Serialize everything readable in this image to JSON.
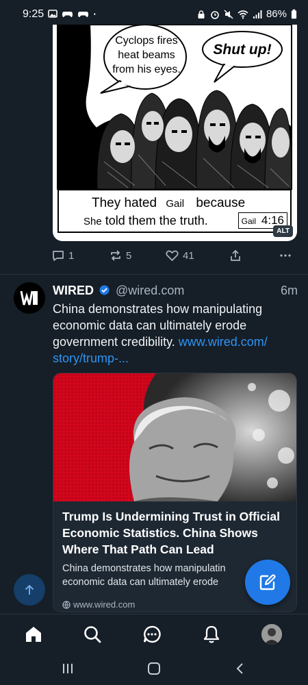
{
  "status_bar": {
    "time": "9:25",
    "battery": "86%"
  },
  "comic": {
    "bubble_left": "Cyclops fires heat beams from his eyes.",
    "bubble_left_lines": [
      "Cyclops fires",
      "heat beams",
      "from his eyes."
    ],
    "bubble_right": "Shut up!",
    "caption_part1": "They hated",
    "caption_fill1": "Gail",
    "caption_part2": "because",
    "caption_fill2": "She",
    "caption_part3": "told them the truth.",
    "sign_name": "Gail",
    "sign_ref": "4:16",
    "alt_badge": "ALT"
  },
  "actions_prev": {
    "replies": "1",
    "reposts": "5",
    "likes": "41"
  },
  "post": {
    "author": "WIRED",
    "handle": "@wired.com",
    "time": "6m",
    "text": "China demonstrates how manipulating economic data can ultimately erode government credibility.",
    "link_text": "www.wired.com/story/trump-...",
    "link_text_1": "www.wired.com/",
    "link_text_2": "story/trump-..."
  },
  "link_card": {
    "title": "Trump Is Undermining Trust in Official Economic Statistics. China Shows Where That Path Can Lead",
    "description": "China demonstrates how manipulating economic data can ultimately erode government credibility.",
    "description_line1": "China demonstrates how manipulatin",
    "description_line2": "economic data can ultimately erode",
    "domain": "www.wired.com"
  },
  "colors": {
    "background": "#161e27",
    "accent": "#2079e6",
    "link": "#2d95f5",
    "muted": "#a9b6c3",
    "verified": "#2079e6"
  },
  "icons": {
    "home": "home-icon",
    "search": "search-icon",
    "chat": "chat-icon",
    "notifications": "bell-icon",
    "compose": "compose-icon",
    "scroll_top": "arrow-up-icon"
  }
}
